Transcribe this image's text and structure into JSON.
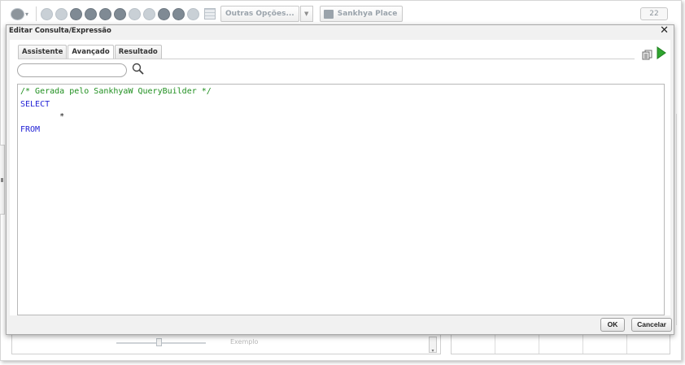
{
  "background_app": {
    "toolbar": {
      "more_options_label": "Outras Opções...",
      "place_label": "Sankhya Place",
      "counter": "22"
    },
    "example_text": "Exemplo"
  },
  "dialog": {
    "title": "Editar Consulta/Expressão",
    "close_glyph": "✕",
    "tabs": [
      {
        "label": "Assistente",
        "active": false
      },
      {
        "label": "Avançado",
        "active": true
      },
      {
        "label": "Resultado",
        "active": false
      }
    ],
    "search": {
      "value": "",
      "placeholder": ""
    },
    "editor": {
      "lines": [
        "/* Gerada pelo SankhyaW QueryBuilder */",
        "SELECT",
        "        *",
        "FROM"
      ]
    },
    "buttons": {
      "ok": "OK",
      "cancel": "Cancelar"
    }
  },
  "colors": {
    "comment": "#1f8f1f",
    "keyword": "#2323d6",
    "run_icon": "#2fa52f"
  },
  "icons": {
    "close": "close-icon",
    "search": "search-icon",
    "copy": "copy-icon",
    "run": "play-icon"
  }
}
